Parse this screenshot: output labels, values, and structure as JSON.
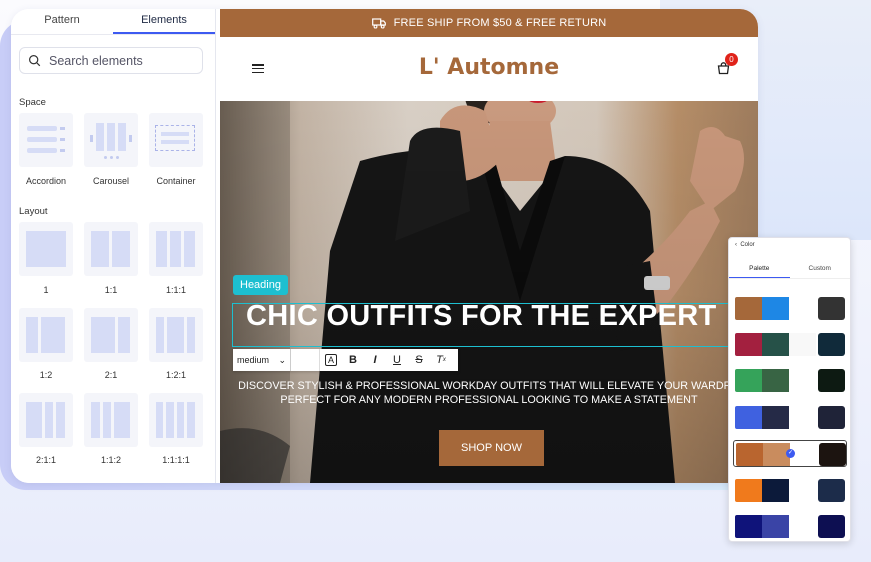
{
  "panel": {
    "tabs": [
      "Pattern",
      "Elements"
    ],
    "active_tab": "Elements",
    "search_placeholder": "Search elements",
    "space_label": "Space",
    "layout_label": "Layout",
    "space_items": [
      "Accordion",
      "Carousel",
      "Container"
    ],
    "layout_items": [
      "1",
      "1:1",
      "1:1:1",
      "1:2",
      "2:1",
      "1:2:1",
      "2:1:1",
      "1:1:2",
      "1:1:1:1"
    ]
  },
  "store": {
    "promo_text": "FREE SHIP FROM $50 & FREE RETURN",
    "logo": "L' Automne",
    "cart_count": "0",
    "hero_tag": "Heading",
    "hero_title": "CHIC OUTFITS FOR THE EXPERT",
    "hero_sub_line1": "DISCOVER STYLISH & PROFESSIONAL WORKDAY OUTFITS THAT WILL ELEVATE YOUR WARDRO",
    "hero_sub_line2": "PERFECT FOR ANY MODERN PROFESSIONAL LOOKING TO MAKE A STATEMENT",
    "shop_button": "SHOP NOW",
    "toolbar_select": "medium",
    "toolbar_buttons": [
      "B",
      "I",
      "U",
      "S"
    ]
  },
  "color_panel": {
    "title": "Color",
    "tabs": [
      "Palette",
      "Custom"
    ],
    "active_tab": "Palette",
    "palettes": [
      [
        "#a5683a",
        "#1e87e5",
        "#ffffff",
        "#333333"
      ],
      [
        "#a3203f",
        "#265148",
        "#f8f8f8",
        "#102a3a"
      ],
      [
        "#35a35a",
        "#386444",
        "#ffffff",
        "#0d1a12"
      ],
      [
        "#3f61e0",
        "#252a47",
        "#ffffff",
        "#1f2338"
      ],
      [
        "#b9652f",
        "#c98c5e",
        "#ffffff",
        "#1c1410"
      ],
      [
        "#f07a1c",
        "#0c1a3a",
        "#ffffff",
        "#1c2c4a"
      ],
      [
        "#0f137a",
        "#3a44a6",
        "#ffffff",
        "#0d0f52"
      ]
    ],
    "selected_index": 4
  }
}
